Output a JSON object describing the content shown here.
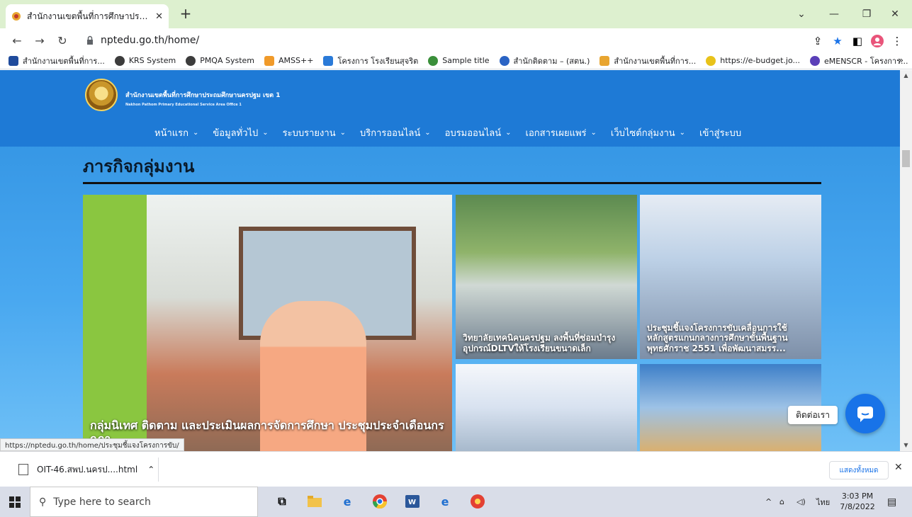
{
  "browser": {
    "tab_title": "สำนักงานเขตพื้นที่การศึกษาประถมศึก",
    "url": "nptedu.go.th/home/",
    "bookmarks": [
      {
        "label": "สำนักงานเขตพื้นที่การ...",
        "color": "#1f4b9c"
      },
      {
        "label": "KRS System",
        "color": "#3c3c3c"
      },
      {
        "label": "PMQA System",
        "color": "#3c3c3c"
      },
      {
        "label": "AMSS++",
        "color": "#f09a2a"
      },
      {
        "label": "โครงการ โรงเรียนสุจริต",
        "color": "#2a7ad8"
      },
      {
        "label": "Sample title",
        "color": "#3a8f3a"
      },
      {
        "label": "สำนักติดตาม – (สตน.)",
        "color": "#2a63c4"
      },
      {
        "label": "สำนักงานเขตพื้นที่การ...",
        "color": "#e8a530"
      },
      {
        "label": "https://e-budget.jo...",
        "color": "#e8c21a"
      },
      {
        "label": "eMENSCR - โครงการ...",
        "color": "#5a3fb8"
      }
    ],
    "status_url": "https://nptedu.go.th/home/ประชุมชี้แจงโครงการขับ/"
  },
  "site": {
    "org_name_th": "สำนักงานเขตพื้นที่การศึกษาประถมศึกษานครปฐม เขต 1",
    "org_name_en": "Nakhon Pathom Primary Educational Service Area Office 1",
    "menu": [
      "หน้าแรก",
      "ข้อมูลทั่วไป",
      "ระบบรายงาน",
      "บริการออนไลน์",
      "อบรมออนไลน์",
      "เอกสารเผยแพร่",
      "เว็บไซต์กลุ่มงาน",
      "เข้าสู่ระบบ"
    ],
    "section_title": "ภารกิจกลุ่มงาน",
    "cards": [
      {
        "caption": "กลุ่มนิเทศ ติดตาม และประเมินผลการจัดการศึกษา ประชุมประจำเดือนกรกฎา"
      },
      {
        "caption": "วิทยาลัยเทคนิคนครปฐม ลงพื้นที่ซ่อมบำรุง อุปกรณ์DLTVให้โรงเรียนขนาดเล็ก"
      },
      {
        "caption": "ประชุมชี้แจงโครงการขับเคลื่อนการใช้ หลักสูตรแกนกลางการศึกษาขั้นพื้นฐาน พุทธศักราช 2551 เพื่อพัฒนาสมรร..."
      },
      {
        "caption": ""
      },
      {
        "caption": ""
      }
    ],
    "chat_label": "ติดต่อเรา"
  },
  "downloads": {
    "file": "OIT-46.สพป.นครป....html",
    "show_all": "แสดงทั้งหมด"
  },
  "taskbar": {
    "search_placeholder": "Type here to search",
    "lang": "ไทย",
    "time": "3:03 PM",
    "date": "7/8/2022"
  }
}
